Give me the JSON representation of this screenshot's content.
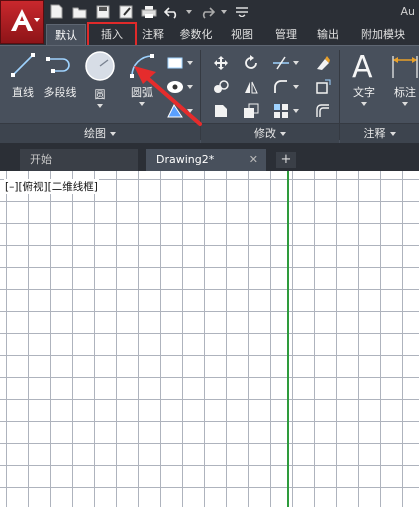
{
  "app": {
    "title": "Au",
    "logo_letter": "A"
  },
  "quick_access": [
    "new-icon",
    "open-icon",
    "save-icon",
    "saveas-icon",
    "print-icon",
    "undo-icon",
    "redo-icon",
    "workspace-icon"
  ],
  "ribbon_tabs": [
    {
      "label": "默认",
      "active": true
    },
    {
      "label": "插入",
      "highlight": true
    },
    {
      "label": "注释"
    },
    {
      "label": "参数化"
    },
    {
      "label": "视图"
    },
    {
      "label": "管理"
    },
    {
      "label": "输出"
    },
    {
      "label": "附加模块"
    }
  ],
  "draw_panel": {
    "title": "绘图",
    "tools": [
      {
        "label": "直线",
        "icon": "line-icon"
      },
      {
        "label": "多段线",
        "icon": "polyline-icon"
      },
      {
        "label": "圆",
        "icon": "circle-icon"
      },
      {
        "label": "圆弧",
        "icon": "arc-icon"
      }
    ]
  },
  "modify_panel": {
    "title": "修改"
  },
  "annotation_panel": {
    "title": "注释",
    "tools": [
      {
        "label": "文字",
        "icon": "text-icon"
      },
      {
        "label": "标注",
        "icon": "dimension-icon"
      }
    ]
  },
  "doc_tabs": [
    {
      "label": "开始"
    },
    {
      "label": "Drawing2*",
      "active": true,
      "close": "✕"
    }
  ],
  "new_tab_label": "+",
  "viewport": {
    "label": "[–][俯视][二维线框]"
  },
  "colors": {
    "highlight": "#e02a2a",
    "axis": "#2e9b3c",
    "ribbon_bg": "#48505c"
  }
}
